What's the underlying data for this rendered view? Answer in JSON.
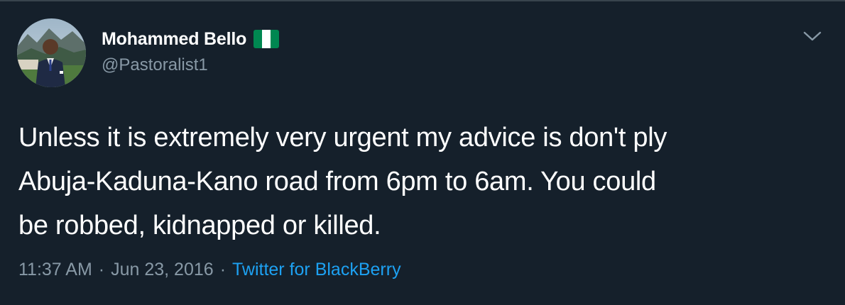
{
  "author": {
    "display_name": "Mohammed Bello",
    "handle": "@Pastoralist1",
    "flag_icon": "nigeria-flag-icon",
    "flag_colors": [
      "#008751",
      "#ffffff",
      "#008751"
    ]
  },
  "tweet": {
    "lines": [
      "Unless it is extremely very urgent my advice is don't ply",
      "Abuja-Kaduna-Kano road from 6pm to 6am. You could",
      "be robbed, kidnapped or killed."
    ],
    "time": "11:37 AM",
    "separator": "·",
    "date": "Jun 23, 2016",
    "source": "Twitter for BlackBerry"
  },
  "icons": {
    "menu": "chevron-down-icon",
    "avatar": "avatar"
  },
  "colors": {
    "background": "#15202b",
    "primary_text": "#ffffff",
    "secondary_text": "#8899a6",
    "link": "#1da1f2",
    "divider": "#38444d"
  }
}
